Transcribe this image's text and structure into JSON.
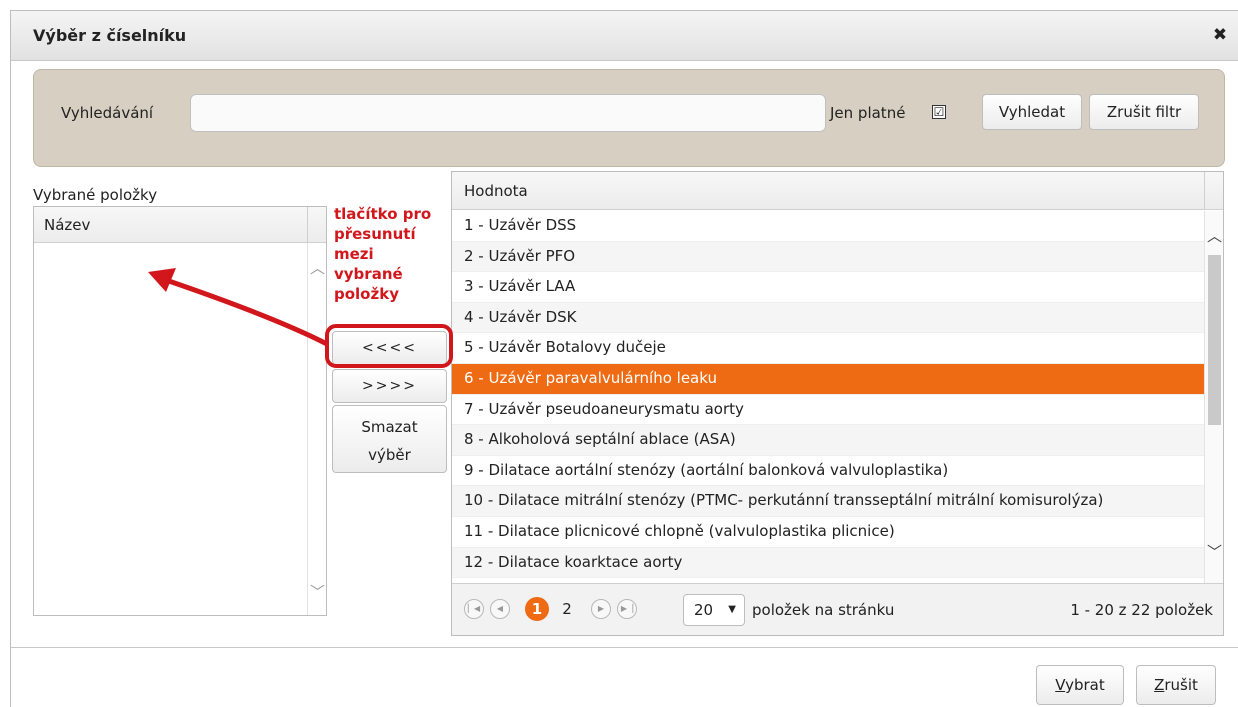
{
  "dialog": {
    "title": "Výběr z číselníku",
    "close_icon": "close-icon"
  },
  "filter": {
    "search_label": "Vyhledávání",
    "search_value": "",
    "valid_label": "Jen platné",
    "valid_checked": true,
    "checkbox_mark": "☑",
    "search_button": "Vyhledat",
    "clear_button": "Zrušit filtr"
  },
  "selected": {
    "label": "Vybrané položky",
    "column_header": "Název",
    "items": []
  },
  "middle": {
    "move_left": "<<<<",
    "move_right": ">>>>",
    "clear_selection_line1": "Smazat",
    "clear_selection_line2": "výběr"
  },
  "annotation": {
    "line1": "tlačítko pro",
    "line2": "přesunutí",
    "line3": "mezi",
    "line4": "vybrané",
    "line5": "položky",
    "color": "#d2171c"
  },
  "list": {
    "column_header": "Hodnota",
    "rows": [
      "1 - Uzávěr DSS",
      "2 - Uzávěr PFO",
      "3 - Uzávěr LAA",
      "4 - Uzávěr DSK",
      "5 - Uzávěr Botalovy dučeje",
      "6 - Uzávěr paravalvulárního leaku",
      "7 - Uzávěr pseudoaneurysmatu aorty",
      "8 - Alkoholová septální ablace (ASA)",
      "9 - Dilatace aortální stenózy (aortální balonková valvuloplastika)",
      "10 - Dilatace mitrální stenózy (PTMC- perkutánní transseptální mitrální komisurolýza)",
      "11 - Dilatace plicnicové chlopně (valvuloplastika plicnice)",
      "12 - Dilatace koarktace aorty"
    ],
    "selected_index": 5,
    "accent_color": "#ee6b14"
  },
  "pager": {
    "first_icon": "first-page-icon",
    "prev_icon": "prev-page-icon",
    "next_icon": "next-page-icon",
    "last_icon": "last-page-icon",
    "page1": "1",
    "page2": "2",
    "page_size": "20",
    "per_page_label": "položek na stránku",
    "range": "1 - 20 z 22 položek"
  },
  "footer": {
    "select_button": "Vybrat",
    "cancel_button": "Zrušit"
  }
}
